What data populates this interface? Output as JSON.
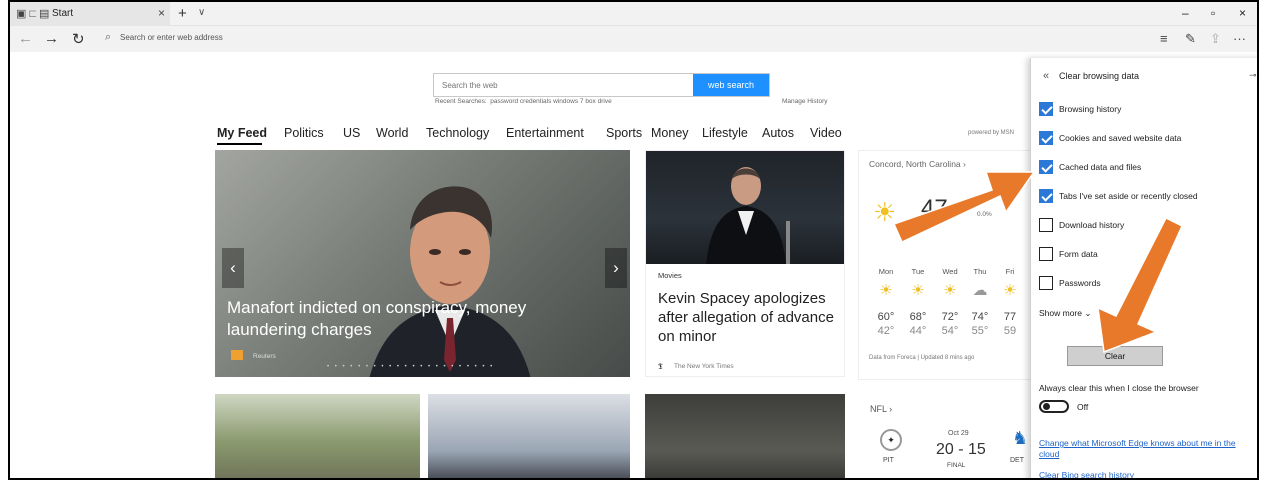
{
  "titlebar": {
    "tab_title": "Start",
    "tab_close": "×",
    "new_tab": "+",
    "tab_preview": "∨",
    "minimize": "–",
    "maximize": "▫",
    "close": "×"
  },
  "addressbar": {
    "back": "←",
    "forward": "→",
    "refresh": "↻",
    "placeholder": "Search or enter web address",
    "hub": "≡",
    "notes": "✎",
    "share": "⇪",
    "more": "···"
  },
  "search": {
    "placeholder": "Search the web",
    "button": "web search",
    "recent_label": "Recent Searches:",
    "recent_items": "password credentials windows 7   box drive",
    "manage_history": "Manage History"
  },
  "feed": {
    "tabs": [
      "My Feed",
      "Politics",
      "US",
      "World",
      "Technology",
      "Entertainment",
      "Sports",
      "Money",
      "Lifestyle",
      "Autos",
      "Video"
    ],
    "powered_by": "powered by MSN"
  },
  "hero": {
    "headline": "Manafort indicted on conspiracy, money laundering charges",
    "source": "Reuters",
    "prev": "‹",
    "next": "›",
    "dots": "• • • • • • • • • • • • • • • • • • • • • •"
  },
  "story2": {
    "category": "Movies",
    "headline": "Kevin Spacey apologizes after allegation of advance on minor",
    "source": "The New York Times"
  },
  "weather": {
    "location": "Concord, North Carolina  ›",
    "current_temp": "47",
    "precip": "0.0%",
    "days": [
      {
        "day": "Mon",
        "hi": "60°",
        "lo": "42°"
      },
      {
        "day": "Tue",
        "hi": "68°",
        "lo": "44°"
      },
      {
        "day": "Wed",
        "hi": "72°",
        "lo": "54°"
      },
      {
        "day": "Thu",
        "hi": "74°",
        "lo": "55°"
      },
      {
        "day": "Fri",
        "hi": "77",
        "lo": "59"
      }
    ],
    "footer": "Data from Foreca | Updated 8 mins ago"
  },
  "nfl": {
    "label": "NFL  ›",
    "team1": "PIT",
    "date": "Oct 29",
    "score": "20 - 15",
    "status": "FINAL",
    "team2": "DET"
  },
  "panel": {
    "back": "«",
    "title": "Clear browsing data",
    "pin": "⊸",
    "options": [
      {
        "label": "Browsing history",
        "checked": true
      },
      {
        "label": "Cookies and saved website data",
        "checked": true
      },
      {
        "label": "Cached data and files",
        "checked": true
      },
      {
        "label": "Tabs I've set aside or recently closed",
        "checked": true
      },
      {
        "label": "Download history",
        "checked": false
      },
      {
        "label": "Form data",
        "checked": false
      },
      {
        "label": "Passwords",
        "checked": false
      }
    ],
    "show_more": "Show more ⌄",
    "clear_button": "Clear",
    "always_clear": "Always clear this when I close the browser",
    "toggle_state": "Off",
    "link1": "Change what Microsoft Edge knows about me in the cloud",
    "link2": "Clear Bing search history"
  },
  "colors": {
    "accent": "#2b78d6",
    "search_button": "#1e90ff",
    "annotation_arrow": "#e8792b"
  }
}
